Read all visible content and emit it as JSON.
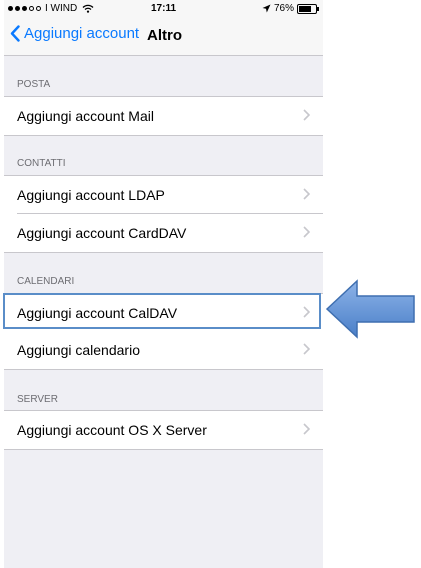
{
  "status_bar": {
    "carrier": "I WIND",
    "time": "17:11",
    "battery": "76%",
    "battery_level": 0.76
  },
  "nav": {
    "back_label": "Aggiungi account",
    "title": "Altro"
  },
  "sections": [
    {
      "header": "POSTA",
      "items": [
        "Aggiungi account Mail"
      ]
    },
    {
      "header": "CONTATTI",
      "items": [
        "Aggiungi account LDAP",
        "Aggiungi account CardDAV"
      ]
    },
    {
      "header": "CALENDARI",
      "items": [
        "Aggiungi account CalDAV",
        "Aggiungi calendario"
      ]
    },
    {
      "header": "SERVER",
      "items": [
        "Aggiungi account OS X Server"
      ]
    }
  ],
  "colors": {
    "accent": "#0a7aff",
    "background": "#efeff4",
    "highlight_border": "#5a8dc8",
    "arrow": "#5b8fd1"
  },
  "icons": {
    "back": "chevron-left-icon",
    "row": "chevron-right-icon",
    "location": "location-arrow-icon",
    "wifi": "wifi-icon",
    "battery": "battery-icon",
    "callout": "arrow-left-icon"
  }
}
